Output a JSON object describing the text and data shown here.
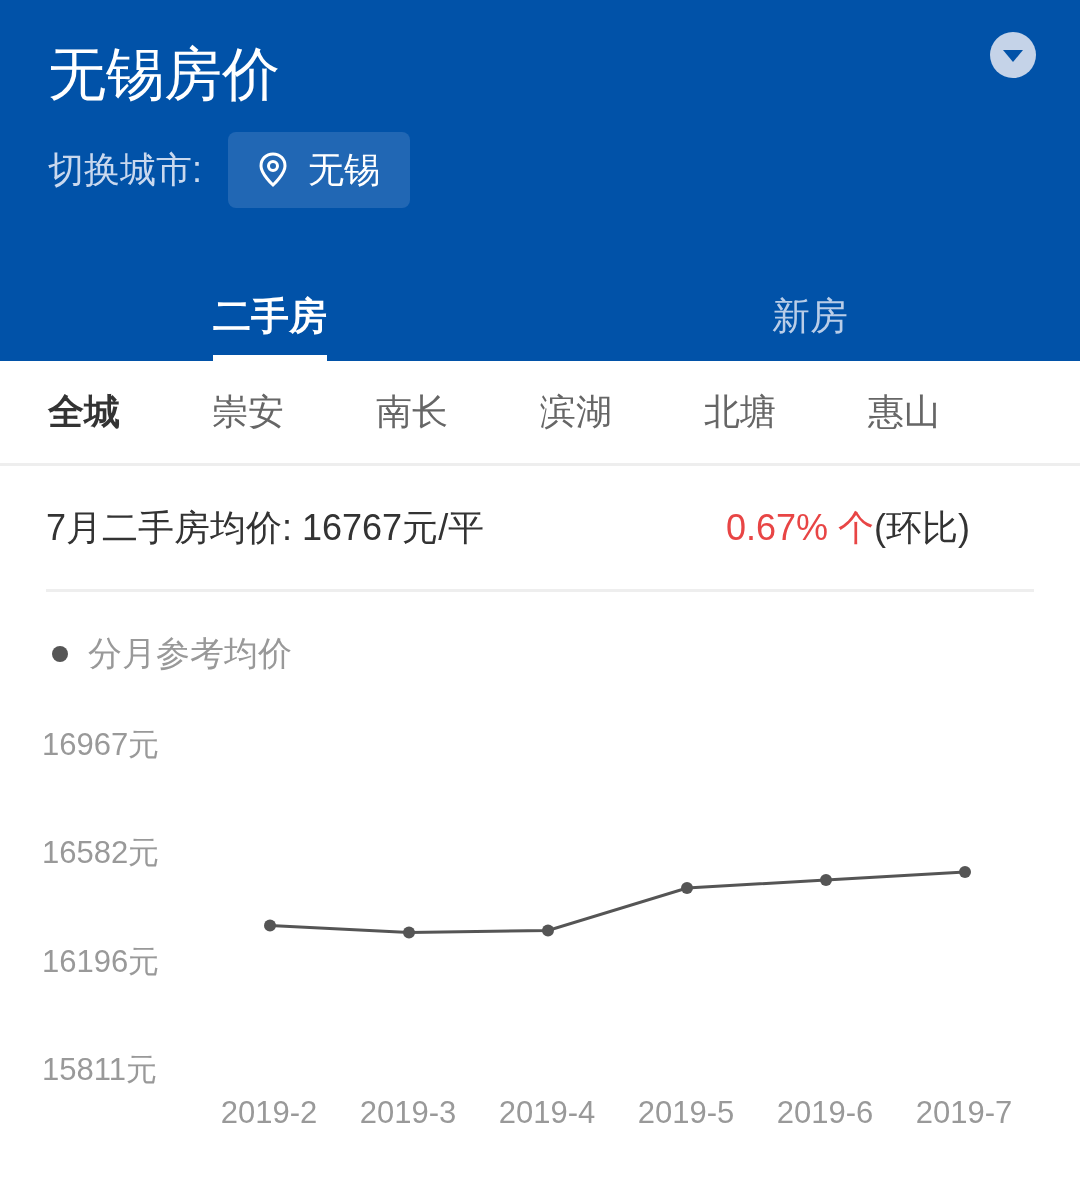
{
  "header": {
    "title": "无锡房价",
    "city_label": "切换城市:",
    "city": "无锡"
  },
  "tabs": [
    {
      "label": "二手房",
      "selected": true
    },
    {
      "label": "新房",
      "selected": false
    }
  ],
  "districts": [
    {
      "label": "全城",
      "selected": true
    },
    {
      "label": "崇安",
      "selected": false
    },
    {
      "label": "南长",
      "selected": false
    },
    {
      "label": "滨湖",
      "selected": false
    },
    {
      "label": "北塘",
      "selected": false
    },
    {
      "label": "惠山",
      "selected": false
    }
  ],
  "summary": {
    "text": "7月二手房均价: 16767元/平",
    "change": "0.67% 个",
    "change_note": "(环比)"
  },
  "chart_data": {
    "type": "line",
    "categories": [
      "2019-2",
      "2019-3",
      "2019-4",
      "2019-5",
      "2019-6",
      "2019-7"
    ],
    "series": [
      {
        "name": "分月参考均价",
        "color": "#555555",
        "marker": "circle",
        "values": [
          16318,
          16293,
          16300,
          16451,
          16480,
          16508
        ]
      }
    ],
    "ylim": [
      15811,
      16967
    ],
    "yticks": [
      {
        "value": 15811,
        "label": "15811元"
      },
      {
        "value": 16196,
        "label": "16196元"
      },
      {
        "value": 16582,
        "label": "16582元"
      },
      {
        "value": 16967,
        "label": "16967元"
      }
    ]
  }
}
